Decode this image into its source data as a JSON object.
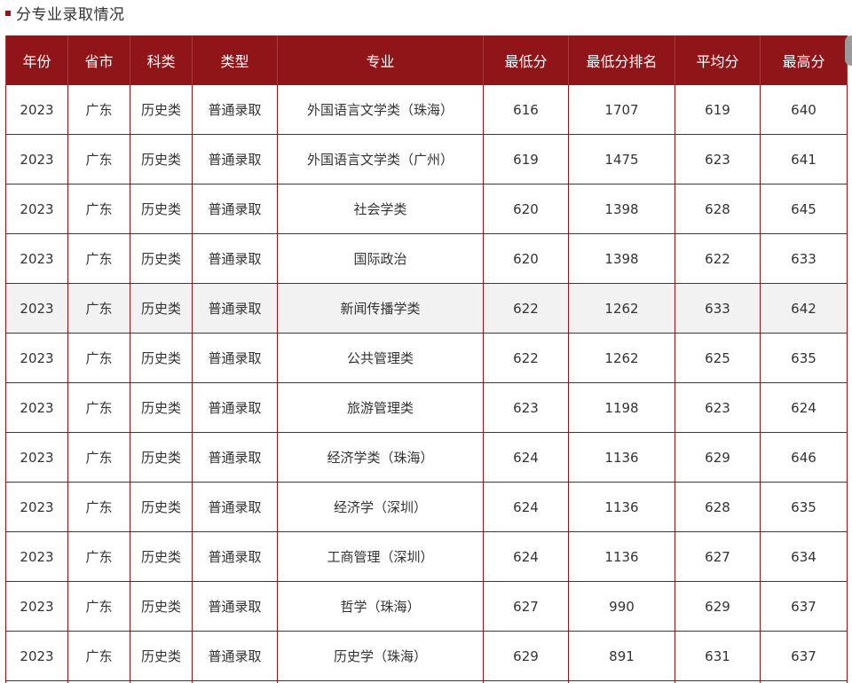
{
  "section": {
    "title": "分专业录取情况",
    "accent_color": "#8f1519"
  },
  "table": {
    "headers": [
      "年份",
      "省市",
      "科类",
      "类型",
      "专业",
      "最低分",
      "最低分排名",
      "平均分",
      "最高分"
    ],
    "rows": [
      [
        "2023",
        "广东",
        "历史类",
        "普通录取",
        "外国语言文学类（珠海）",
        "616",
        "1707",
        "619",
        "640"
      ],
      [
        "2023",
        "广东",
        "历史类",
        "普通录取",
        "外国语言文学类（广州）",
        "619",
        "1475",
        "623",
        "641"
      ],
      [
        "2023",
        "广东",
        "历史类",
        "普通录取",
        "社会学类",
        "620",
        "1398",
        "628",
        "645"
      ],
      [
        "2023",
        "广东",
        "历史类",
        "普通录取",
        "国际政治",
        "620",
        "1398",
        "622",
        "633"
      ],
      [
        "2023",
        "广东",
        "历史类",
        "普通录取",
        "新闻传播学类",
        "622",
        "1262",
        "633",
        "642"
      ],
      [
        "2023",
        "广东",
        "历史类",
        "普通录取",
        "公共管理类",
        "622",
        "1262",
        "625",
        "635"
      ],
      [
        "2023",
        "广东",
        "历史类",
        "普通录取",
        "旅游管理类",
        "623",
        "1198",
        "623",
        "624"
      ],
      [
        "2023",
        "广东",
        "历史类",
        "普通录取",
        "经济学类（珠海）",
        "624",
        "1136",
        "629",
        "646"
      ],
      [
        "2023",
        "广东",
        "历史类",
        "普通录取",
        "经济学（深圳）",
        "624",
        "1136",
        "628",
        "635"
      ],
      [
        "2023",
        "广东",
        "历史类",
        "普通录取",
        "工商管理（深圳）",
        "624",
        "1136",
        "627",
        "634"
      ],
      [
        "2023",
        "广东",
        "历史类",
        "普通录取",
        "哲学（珠海）",
        "627",
        "990",
        "629",
        "637"
      ],
      [
        "2023",
        "广东",
        "历史类",
        "普通录取",
        "历史学（珠海）",
        "629",
        "891",
        "631",
        "637"
      ]
    ],
    "highlighted_row": 4
  }
}
